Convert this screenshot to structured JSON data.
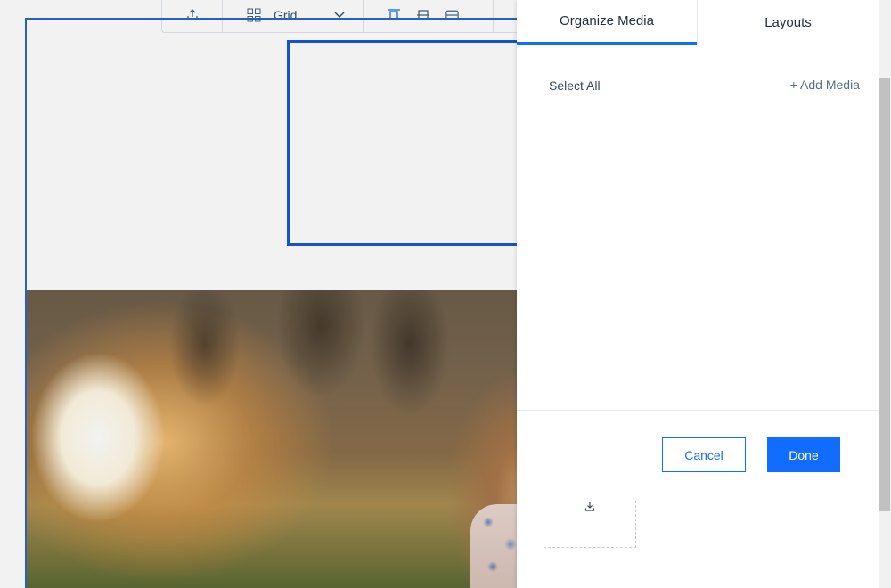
{
  "toolbar": {
    "layout_label": "Grid",
    "icons": [
      "upload-icon",
      "grid-icon",
      "chevron-down-icon",
      "align-top-icon",
      "align-middle-icon",
      "align-bottom-icon"
    ]
  },
  "panel": {
    "tabs": [
      {
        "label": "Organize Media",
        "active": true
      },
      {
        "label": "Layouts",
        "active": false
      }
    ],
    "select_all_label": "Select All",
    "add_media_label": "+ Add Media",
    "cancel_label": "Cancel",
    "done_label": "Done",
    "upload_icon": "upload-icon"
  },
  "colors": {
    "accent": "#116dff",
    "selection": "#1a57d3",
    "text": "#20303c"
  }
}
